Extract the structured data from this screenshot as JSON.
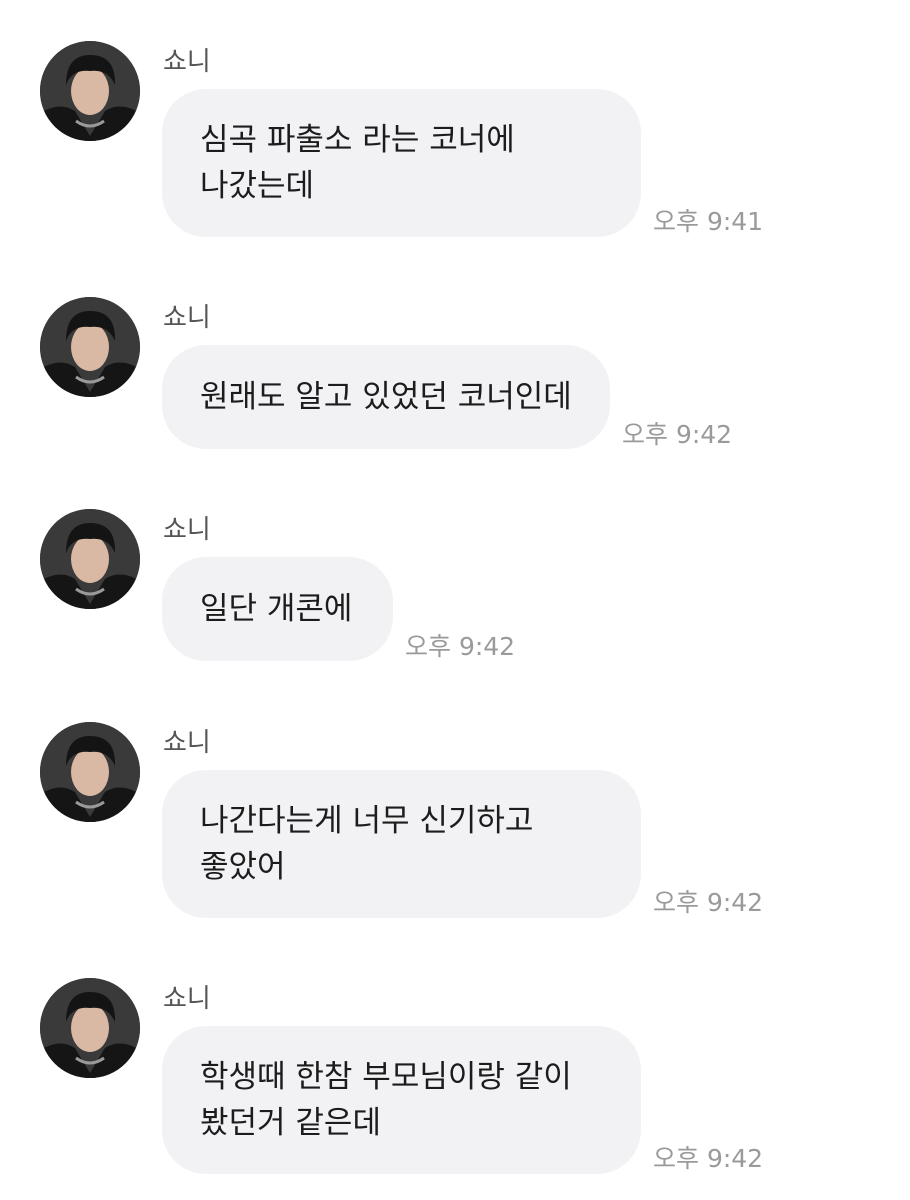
{
  "messages": [
    {
      "sender": "쇼니",
      "text": "심곡 파출소 라는 코너에\n나갔는데",
      "time": "오후 9:41"
    },
    {
      "sender": "쇼니",
      "text": "원래도 알고 있었던 코너인데",
      "time": "오후 9:42"
    },
    {
      "sender": "쇼니",
      "text": "일단 개콘에",
      "time": "오후 9:42"
    },
    {
      "sender": "쇼니",
      "text": "나간다는게 너무 신기하고\n좋았어",
      "time": "오후 9:42"
    },
    {
      "sender": "쇼니",
      "text": "학생때 한참 부모님이랑 같이\n봤던거 같은데",
      "time": "오후 9:42"
    }
  ]
}
